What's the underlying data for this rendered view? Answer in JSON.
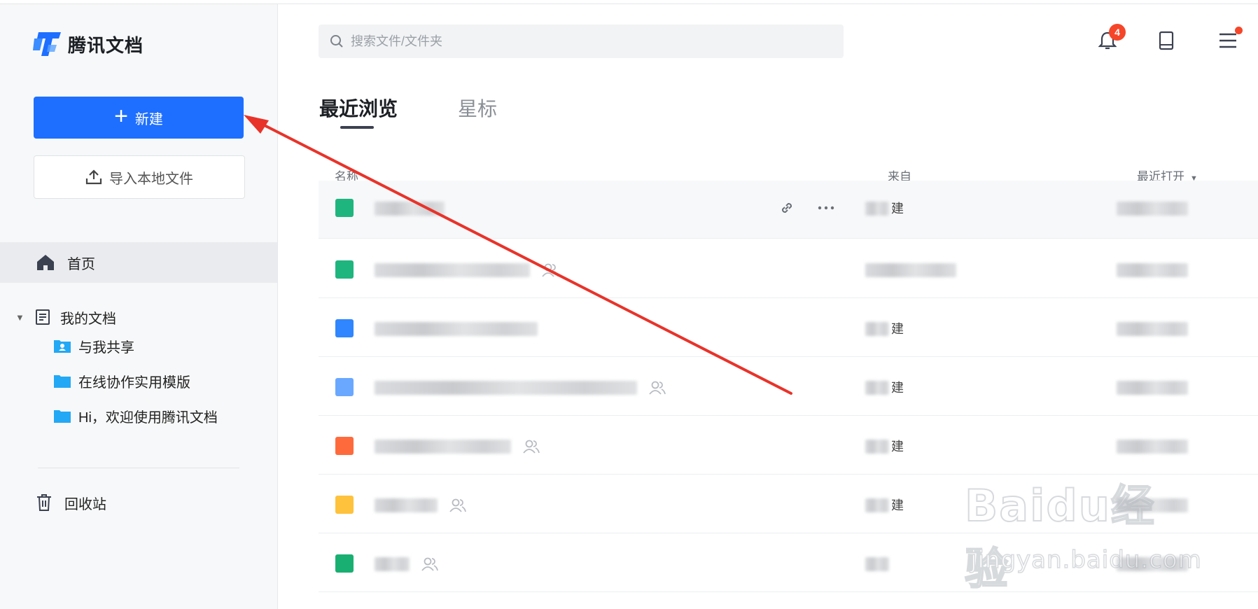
{
  "app": {
    "logo_text": "腾讯文档"
  },
  "sidebar": {
    "new_button": "新建",
    "import_button": "导入本地文件",
    "nav": {
      "home": "首页",
      "my_docs": "我的文档",
      "folders": [
        "与我共享",
        "在线协作实用模版",
        "Hi，欢迎使用腾讯文档"
      ],
      "trash": "回收站"
    }
  },
  "header": {
    "search_placeholder": "搜索文件/文件夹",
    "notification_count": "4"
  },
  "tabs": {
    "recent": "最近浏览",
    "starred": "星标"
  },
  "table": {
    "col_name": "名称",
    "col_from": "来自",
    "col_opened": "最近打开",
    "rows": [
      {
        "from_suffix": "建",
        "icon_color": "#1fb57e",
        "shared": false
      },
      {
        "from_suffix": "",
        "icon_color": "#1fb57e",
        "shared": true
      },
      {
        "from_suffix": "建",
        "icon_color": "#2f86ff",
        "shared": false
      },
      {
        "from_suffix": "建",
        "icon_color": "#6aa8ff",
        "shared": true
      },
      {
        "from_suffix": "建",
        "icon_color": "#ff6a3d",
        "shared": true
      },
      {
        "from_suffix": "建",
        "icon_color": "#ffc23d",
        "shared": true
      },
      {
        "from_suffix": "",
        "icon_color": "#1aaf72",
        "shared": true
      }
    ]
  },
  "colors": {
    "primary": "#1e6fff",
    "badge": "#f5462a",
    "arrow": "#e8332a"
  },
  "watermark": {
    "logo": "Baidu经验",
    "url": "jingyan.baidu.com"
  }
}
